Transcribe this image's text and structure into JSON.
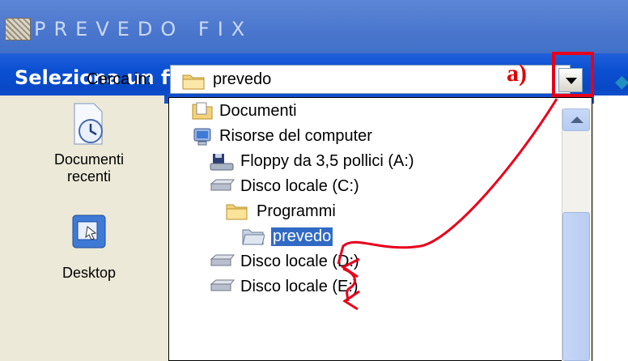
{
  "outer_window": {
    "title": "PREVEDO FIX"
  },
  "dialog": {
    "title": "Seleziona un file progetto di PREVEDO",
    "look_in": {
      "label": "Cerca in:",
      "value": "prevedo"
    },
    "annotation": "a)"
  },
  "places": [
    {
      "label_line1": "Documenti",
      "label_line2": "recenti",
      "icon": "recent-documents-icon"
    },
    {
      "label_line1": "Desktop",
      "label_line2": "",
      "icon": "desktop-icon"
    }
  ],
  "dropdown_items": [
    {
      "label": "Documenti",
      "icon": "documents-folder-icon",
      "level": 0
    },
    {
      "label": "Risorse del computer",
      "icon": "my-computer-icon",
      "level": 0
    },
    {
      "label": "Floppy da 3,5 pollici (A:)",
      "icon": "floppy-drive-icon",
      "level": 1
    },
    {
      "label": "Disco locale (C:)",
      "icon": "hard-drive-icon",
      "level": 1
    },
    {
      "label": "Programmi",
      "icon": "folder-icon",
      "level": 2
    },
    {
      "label": "prevedo",
      "icon": "open-folder-icon",
      "level": 3,
      "selected": true
    },
    {
      "label": "Disco locale (D:)",
      "icon": "hard-drive-icon",
      "level": 1
    },
    {
      "label": "Disco locale (E:)",
      "icon": "hard-drive-icon",
      "level": 1
    }
  ],
  "colors": {
    "annotation_red": "#e8001a",
    "selection": "#316ac5",
    "title_blue": "#0a4fd2"
  }
}
